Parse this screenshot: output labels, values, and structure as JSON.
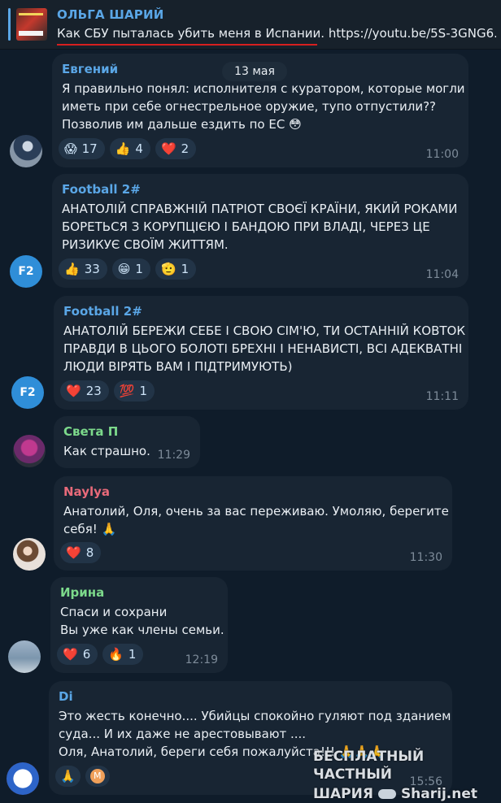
{
  "header": {
    "title": "ОЛЬГА ШАРИЙ",
    "text": "Как СБУ пыталась убить меня в Испании. https://youtu.be/5S-3GNG6...",
    "accent": "#5aa6e6"
  },
  "date_pill": "13 мая",
  "messages": [
    {
      "author": "Евгений",
      "author_color": "#5aa6e6",
      "lines": [
        "Я правильно понял: исполнителя с куратором, которые могли",
        "иметь при себе огнестрельное оружие, тупо отпустили??",
        "Позволив им дальше ездить по ЕС 😳"
      ],
      "reactions": [
        {
          "emoji": "😱",
          "count": "17"
        },
        {
          "emoji": "👍",
          "count": "4"
        },
        {
          "emoji": "❤️",
          "count": "2"
        }
      ],
      "time": "11:00"
    },
    {
      "author": "Football 2#",
      "author_color": "#5aa6e6",
      "avatar_text": "F2",
      "lines": [
        "АНАТОЛІЙ СПРАВЖНІЙ ПАТРІОТ СВОЄЇ КРАЇНИ, ЯКИЙ РОКАМИ",
        "БОРЕТЬСЯ З КОРУПЦІЄЮ І БАНДОЮ ПРИ ВЛАДІ, ЧЕРЕЗ ЦЕ",
        "РИЗИКУЄ СВОЇМ ЖИТТЯМ."
      ],
      "reactions": [
        {
          "emoji": "👍",
          "count": "33"
        },
        {
          "emoji": "😁",
          "count": "1"
        },
        {
          "emoji": "🫡",
          "count": "1"
        }
      ],
      "time": "11:04"
    },
    {
      "author": "Football 2#",
      "author_color": "#5aa6e6",
      "avatar_text": "F2",
      "lines": [
        "АНАТОЛІЙ БЕРЕЖИ СЕБЕ І СВОЮ СІМ'Ю, ТИ ОСТАННІЙ КОВТОК",
        "ПРАВДИ В ЦЬОГО БОЛОТІ БРЕХНІ І НЕНАВИСТІ, ВСІ АДЕКВАТНІ",
        "ЛЮДИ ВІРЯТЬ ВАМ І ПІДТРИМУЮТЬ)"
      ],
      "reactions": [
        {
          "emoji": "❤️",
          "count": "23"
        },
        {
          "emoji": "💯",
          "count": "1"
        }
      ],
      "time": "11:11"
    },
    {
      "author": "Света П",
      "author_color": "#7cd98b",
      "lines": [
        "Как страшно."
      ],
      "reactions": [],
      "time": "11:29"
    },
    {
      "author": "Naylya",
      "author_color": "#e86a7a",
      "lines": [
        "Анатолий, Оля, очень за вас переживаю. Умоляю, берегите",
        "себя! 🙏"
      ],
      "reactions": [
        {
          "emoji": "❤️",
          "count": "8"
        }
      ],
      "time": "11:30"
    },
    {
      "author": "Ирина",
      "author_color": "#7cd98b",
      "lines": [
        "Спаси и сохрани",
        "Вы уже как члены семьи."
      ],
      "reactions": [
        {
          "emoji": "❤️",
          "count": "6"
        },
        {
          "emoji": "🔥",
          "count": "1"
        }
      ],
      "time": "12:19"
    },
    {
      "author": "Di",
      "author_color": "#5aa6e6",
      "lines": [
        "Это жесть конечно.... Убийцы спокойно гуляют под зданием",
        "суда... И их даже не арестовывают ....",
        "Оля, Анатолий, береги себя пожалуйста!!! 🙏🙏🙏"
      ],
      "reactions": [
        {
          "emoji": "🙏",
          "count": ""
        },
        {
          "emoji": "M",
          "count": ""
        }
      ],
      "time": "15:56"
    }
  ],
  "watermark": {
    "line1": "БЕСПЛАТНЫЙ ЧАСТНЫЙ",
    "line2a": "ШАРИЯ",
    "line2b": "Sharij.net"
  }
}
